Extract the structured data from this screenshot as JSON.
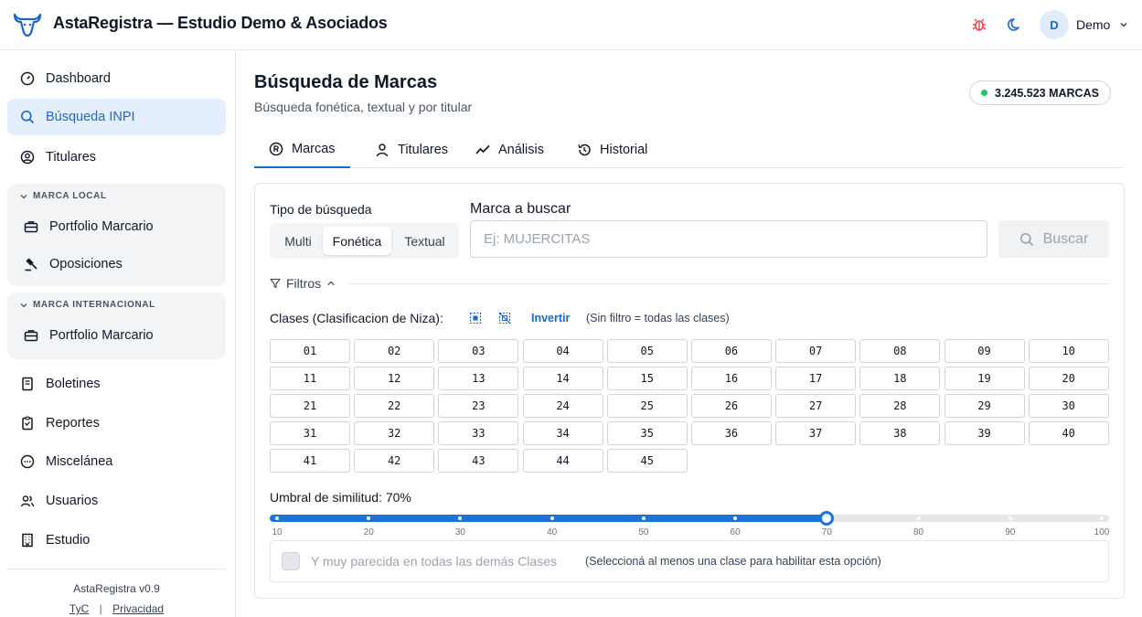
{
  "header": {
    "app_title": "AstaRegistra — Estudio Demo & Asociados",
    "user_initial": "D",
    "user_name": "Demo",
    "icons": [
      "bull-logo-icon",
      "bug-icon",
      "moon-icon",
      "chevron-down-icon"
    ]
  },
  "sidebar": {
    "items_top": [
      {
        "label": "Dashboard",
        "icon": "gauge-icon",
        "active": false
      },
      {
        "label": "Búsqueda INPI",
        "icon": "search-icon",
        "active": true
      },
      {
        "label": "Titulares",
        "icon": "user-circle-icon",
        "active": false
      }
    ],
    "group_local": {
      "title": "MARCA LOCAL",
      "items": [
        {
          "label": "Portfolio Marcario",
          "icon": "briefcase-icon"
        },
        {
          "label": "Oposiciones",
          "icon": "gavel-icon"
        }
      ]
    },
    "group_intl": {
      "title": "MARCA INTERNACIONAL",
      "items": [
        {
          "label": "Portfolio Marcario",
          "icon": "briefcase-icon"
        }
      ]
    },
    "items_bottom": [
      {
        "label": "Boletines",
        "icon": "book-icon"
      },
      {
        "label": "Reportes",
        "icon": "clipboard-icon"
      },
      {
        "label": "Miscelánea",
        "icon": "dots-circle-icon"
      },
      {
        "label": "Usuarios",
        "icon": "users-icon"
      },
      {
        "label": "Estudio",
        "icon": "building-icon"
      }
    ],
    "footer": {
      "version": "AstaRegistra v0.9",
      "link_terms": "TyC",
      "separator": "|",
      "link_privacy": "Privacidad"
    }
  },
  "main": {
    "title": "Búsqueda de Marcas",
    "subtitle": "Búsqueda fonética, textual y por titular",
    "count_badge": "3.245.523 MARCAS",
    "tabs": [
      {
        "label": "Marcas",
        "icon": "registered-icon",
        "active": true
      },
      {
        "label": "Titulares",
        "icon": "person-icon",
        "active": false
      },
      {
        "label": "Análisis",
        "icon": "trend-icon",
        "active": false
      },
      {
        "label": "Historial",
        "icon": "history-icon",
        "active": false
      }
    ],
    "search_type": {
      "label": "Tipo de búsqueda",
      "options": [
        "Multi",
        "Fonética",
        "Textual"
      ],
      "selected": "Fonética"
    },
    "marca": {
      "label": "Marca a buscar",
      "value": "",
      "placeholder": "Ej: MUJERCITAS"
    },
    "search_button": "Buscar",
    "filters": {
      "toggle_label": "Filtros",
      "classes_label": "Clases (Clasificacion de Niza):",
      "invert_label": "Invertir",
      "classes_hint": "(Sin filtro = todas las clases)",
      "classes": [
        "01",
        "02",
        "03",
        "04",
        "05",
        "06",
        "07",
        "08",
        "09",
        "10",
        "11",
        "12",
        "13",
        "14",
        "15",
        "16",
        "17",
        "18",
        "19",
        "20",
        "21",
        "22",
        "23",
        "24",
        "25",
        "26",
        "27",
        "28",
        "29",
        "30",
        "31",
        "32",
        "33",
        "34",
        "35",
        "36",
        "37",
        "38",
        "39",
        "40",
        "41",
        "42",
        "43",
        "44",
        "45"
      ]
    },
    "threshold": {
      "label": "Umbral de similitud: 70%",
      "value": 70,
      "min": 10,
      "max": 100,
      "ticks": [
        "10",
        "20",
        "30",
        "40",
        "50",
        "60",
        "70",
        "80",
        "90",
        "100"
      ]
    },
    "similar_option": {
      "label": "Y muy parecida en todas las demás Clases",
      "hint": "(Seleccioná al menos una clase para habilitar esta opción)"
    }
  },
  "colors": {
    "accent": "#1e66c8",
    "slider": "#1e73d6",
    "active_bg": "#e3effb",
    "status_green": "#22c55e",
    "bug_red": "#ef4444"
  }
}
